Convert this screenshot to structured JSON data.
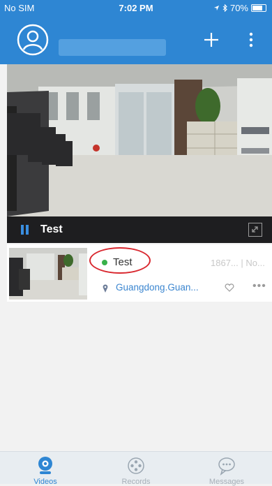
{
  "status": {
    "carrier": "No SIM",
    "time": "7:02 PM",
    "battery": "70%"
  },
  "camera": {
    "name": "Test",
    "device_id": "1867... | No...",
    "location": "Guangdong.Guan...",
    "status_color": "#38b14a"
  },
  "tabs": [
    {
      "label": "Videos",
      "icon": "camera-icon",
      "active": true
    },
    {
      "label": "Records",
      "icon": "film-reel-icon",
      "active": false
    },
    {
      "label": "Messages",
      "icon": "chat-bubble-icon",
      "active": false
    }
  ],
  "colors": {
    "brand": "#2e86d3",
    "highlight": "#d9282f"
  }
}
